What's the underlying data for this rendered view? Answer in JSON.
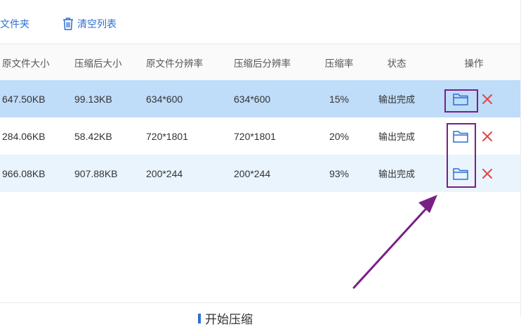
{
  "toolbar": {
    "open_folder_label": "文件夹",
    "clear_list_label": "清空列表"
  },
  "table": {
    "columns": [
      "原文件大小",
      "压缩后大小",
      "原文件分辨率",
      "压缩后分辨率",
      "压缩率",
      "状态",
      "操作"
    ],
    "rows": [
      {
        "original_size": "647.50KB",
        "compressed_size": "99.13KB",
        "original_resolution": "634*600",
        "compressed_resolution": "634*600",
        "rate": "15%",
        "status": "输出完成",
        "selected": true
      },
      {
        "original_size": "284.06KB",
        "compressed_size": "58.42KB",
        "original_resolution": "720*1801",
        "compressed_resolution": "720*1801",
        "rate": "20%",
        "status": "输出完成",
        "selected": false
      },
      {
        "original_size": "966.08KB",
        "compressed_size": "907.88KB",
        "original_resolution": "200*244",
        "compressed_resolution": "200*244",
        "rate": "93%",
        "status": "输出完成",
        "selected": false
      }
    ]
  },
  "icons": {
    "folder": "folder-icon",
    "delete": "close-icon",
    "trash": "trash-icon"
  },
  "colors": {
    "accent": "#2c6fd1",
    "selected_row": "#bfdcf9",
    "alt_row": "#e9f4fd",
    "delete": "#e0474c",
    "annotation": "#7a1f86"
  },
  "bottom": {
    "start_label": "开始压缩"
  }
}
